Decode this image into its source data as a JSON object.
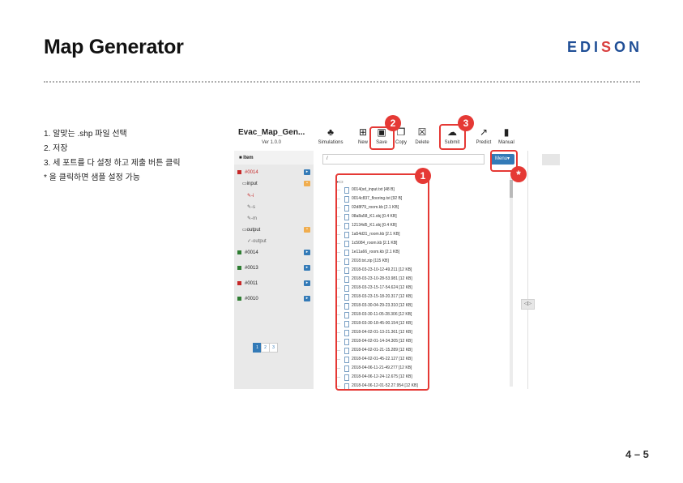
{
  "slide": {
    "title": "Map Generator",
    "logo": {
      "pre": "EDI",
      "mid": "S",
      "post": "ON"
    },
    "page_number": "4 – 5"
  },
  "steps": [
    "1. 알맞는 .shp 파일 선택",
    "2. 저장",
    "3. 세 포트를 다 설정 하고 제출 버튼 클릭",
    "* 을 클릭하면 샘플 설정 가능"
  ],
  "app": {
    "name": "Evac_Map_Gen...",
    "version": "Ver 1.0.0",
    "toolbar": [
      {
        "label": "Simulations",
        "icon": "simulations-icon"
      },
      {
        "label": "New",
        "icon": "new-icon"
      },
      {
        "label": "Save",
        "icon": "save-icon"
      },
      {
        "label": "Copy",
        "icon": "copy-icon"
      },
      {
        "label": "Delete",
        "icon": "delete-icon"
      },
      {
        "label": "Submit",
        "icon": "submit-icon"
      },
      {
        "label": "Predict",
        "icon": "predict-icon"
      },
      {
        "label": "Manual",
        "icon": "manual-icon"
      }
    ],
    "tree": {
      "header": "Item",
      "items": [
        {
          "label": "#0014"
        },
        {
          "label": "input"
        },
        {
          "label": "-i"
        },
        {
          "label": "-s"
        },
        {
          "label": "-m"
        },
        {
          "label": "output"
        },
        {
          "label": "-output"
        },
        {
          "label": "#0014"
        },
        {
          "label": "#0013"
        },
        {
          "label": "#0011"
        },
        {
          "label": "#0010"
        }
      ]
    },
    "pagination": [
      "1",
      "2",
      "3"
    ],
    "path_value": "/",
    "menu_button": "Menu▾",
    "collapse_handle": "◁▷",
    "files": [
      "0014(sd_input.txt [48 B]",
      "0014c837_flooring.txt [92 B]",
      "02d8f79_room.kb [2.1 KB]",
      "08a8a58_K1.obj [0.4 KB]",
      "12134d5_K1.obj [0.4 KB]",
      "1a54d31_room.kb [2.1 KB]",
      "1c5084_room.kb [2.1 KB]",
      "1e11a66_room.kb [2.1 KB]",
      "2018.txt.zip [115 KB]",
      "2018-03-23-10-12-49.211 [12 KB]",
      "2018-03-23-10-28-53.981 [12 KB]",
      "2018-03-23-15-17-54.624 [12 KB]",
      "2018-03-23-15-18-20.317 [12 KB]",
      "2018-03-30-04-29-23.310 [12 KB]",
      "2018-03-30-11-05-28.306 [12 KB]",
      "2018-03-30-18-45-00.154 [12 KB]",
      "2018-04-02-01-13-21.361 [12 KB]",
      "2018-04-02-01-14-34.305 [12 KB]",
      "2018-04-02-01-21-15.289 [12 KB]",
      "2018-04-02-01-45-22.127 [12 KB]",
      "2018-04-06-11-21-49.277 [12 KB]",
      "2018-04-06-12-24-12.675 [12 KB]",
      "2018-04-06-12-01-52.27.954 [12 KB]"
    ]
  },
  "annotations": {
    "markers": [
      "1",
      "2",
      "3",
      "*"
    ],
    "color": "#e53935"
  },
  "colors": {
    "brand_blue": "#1f4e96",
    "accent_blue": "#337ab7",
    "annotation_red": "#e53935"
  }
}
